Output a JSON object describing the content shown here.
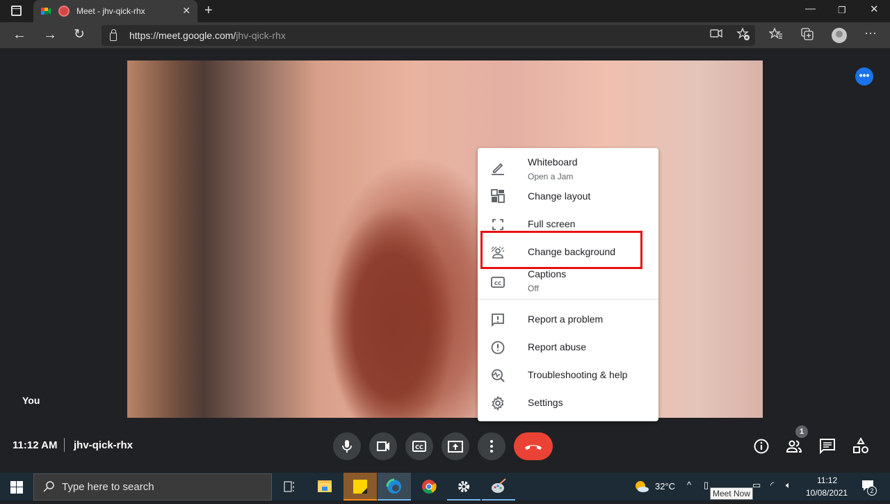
{
  "browser": {
    "tab_title": "Meet - jhv-qick-rhx",
    "url_host": "https://meet.google.com/",
    "url_path": "jhv-qick-rhx",
    "icons": [
      "sidebar-tabs-icon",
      "meet-favicon",
      "recording-icon",
      "close-tab-icon",
      "new-tab-icon",
      "minimize-icon",
      "restore-icon",
      "close-window-icon",
      "back-icon",
      "forward-icon",
      "refresh-icon",
      "lock-icon",
      "camera-icon",
      "add-favorite-icon",
      "favorites-icon",
      "collections-icon",
      "profile-avatar",
      "more-icon"
    ]
  },
  "meet": {
    "participant_label": "You",
    "time": "11:12 AM",
    "meeting_code": "jhv-qick-rhx",
    "participants_count": "1",
    "accent_color": "#1a73e8",
    "end_call_color": "#ea4335"
  },
  "menu": {
    "items": [
      {
        "label": "Whiteboard",
        "sub": "Open a Jam",
        "icon": "pencil-icon"
      },
      {
        "label": "Change layout",
        "icon": "layout-icon"
      },
      {
        "label": "Full screen",
        "icon": "fullscreen-icon"
      },
      {
        "label": "Change background",
        "icon": "background-icon",
        "highlighted": true
      },
      {
        "label": "Captions",
        "sub": "Off",
        "icon": "captions-icon"
      },
      {
        "label": "Report a problem",
        "icon": "feedback-icon"
      },
      {
        "label": "Report abuse",
        "icon": "report-icon"
      },
      {
        "label": "Troubleshooting & help",
        "icon": "troubleshoot-icon"
      },
      {
        "label": "Settings",
        "icon": "settings-icon"
      }
    ]
  },
  "controls": [
    "microphone",
    "camera",
    "captions",
    "present",
    "more-options",
    "end-call"
  ],
  "side_controls": [
    "info",
    "people",
    "chat",
    "activities"
  ],
  "taskbar": {
    "search_placeholder": "Type here to search",
    "temperature": "32°C",
    "time": "11:12",
    "date": "10/08/2021",
    "notifications": "2",
    "tooltip": "Meet Now"
  }
}
